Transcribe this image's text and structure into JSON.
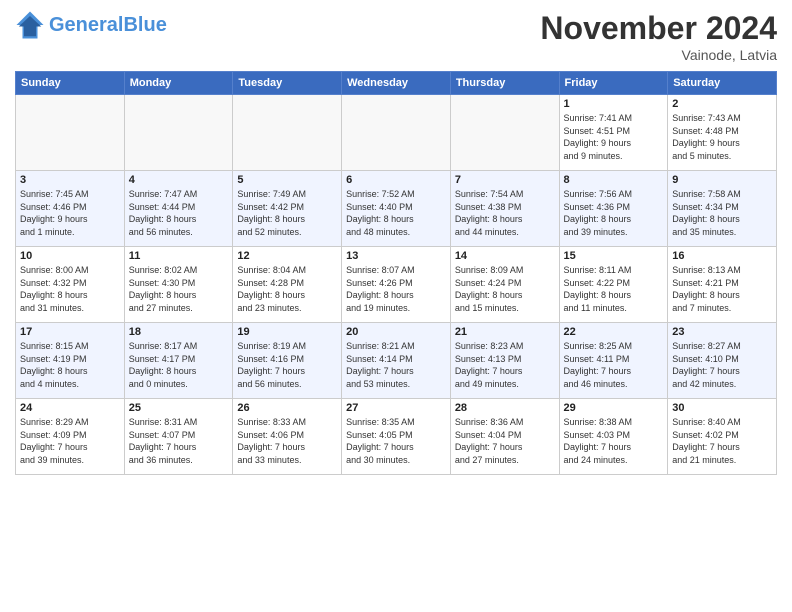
{
  "header": {
    "logo_line1": "General",
    "logo_line2": "Blue",
    "month_title": "November 2024",
    "location": "Vainode, Latvia"
  },
  "weekdays": [
    "Sunday",
    "Monday",
    "Tuesday",
    "Wednesday",
    "Thursday",
    "Friday",
    "Saturday"
  ],
  "weeks": [
    [
      {
        "day": "",
        "info": ""
      },
      {
        "day": "",
        "info": ""
      },
      {
        "day": "",
        "info": ""
      },
      {
        "day": "",
        "info": ""
      },
      {
        "day": "",
        "info": ""
      },
      {
        "day": "1",
        "info": "Sunrise: 7:41 AM\nSunset: 4:51 PM\nDaylight: 9 hours\nand 9 minutes."
      },
      {
        "day": "2",
        "info": "Sunrise: 7:43 AM\nSunset: 4:48 PM\nDaylight: 9 hours\nand 5 minutes."
      }
    ],
    [
      {
        "day": "3",
        "info": "Sunrise: 7:45 AM\nSunset: 4:46 PM\nDaylight: 9 hours\nand 1 minute."
      },
      {
        "day": "4",
        "info": "Sunrise: 7:47 AM\nSunset: 4:44 PM\nDaylight: 8 hours\nand 56 minutes."
      },
      {
        "day": "5",
        "info": "Sunrise: 7:49 AM\nSunset: 4:42 PM\nDaylight: 8 hours\nand 52 minutes."
      },
      {
        "day": "6",
        "info": "Sunrise: 7:52 AM\nSunset: 4:40 PM\nDaylight: 8 hours\nand 48 minutes."
      },
      {
        "day": "7",
        "info": "Sunrise: 7:54 AM\nSunset: 4:38 PM\nDaylight: 8 hours\nand 44 minutes."
      },
      {
        "day": "8",
        "info": "Sunrise: 7:56 AM\nSunset: 4:36 PM\nDaylight: 8 hours\nand 39 minutes."
      },
      {
        "day": "9",
        "info": "Sunrise: 7:58 AM\nSunset: 4:34 PM\nDaylight: 8 hours\nand 35 minutes."
      }
    ],
    [
      {
        "day": "10",
        "info": "Sunrise: 8:00 AM\nSunset: 4:32 PM\nDaylight: 8 hours\nand 31 minutes."
      },
      {
        "day": "11",
        "info": "Sunrise: 8:02 AM\nSunset: 4:30 PM\nDaylight: 8 hours\nand 27 minutes."
      },
      {
        "day": "12",
        "info": "Sunrise: 8:04 AM\nSunset: 4:28 PM\nDaylight: 8 hours\nand 23 minutes."
      },
      {
        "day": "13",
        "info": "Sunrise: 8:07 AM\nSunset: 4:26 PM\nDaylight: 8 hours\nand 19 minutes."
      },
      {
        "day": "14",
        "info": "Sunrise: 8:09 AM\nSunset: 4:24 PM\nDaylight: 8 hours\nand 15 minutes."
      },
      {
        "day": "15",
        "info": "Sunrise: 8:11 AM\nSunset: 4:22 PM\nDaylight: 8 hours\nand 11 minutes."
      },
      {
        "day": "16",
        "info": "Sunrise: 8:13 AM\nSunset: 4:21 PM\nDaylight: 8 hours\nand 7 minutes."
      }
    ],
    [
      {
        "day": "17",
        "info": "Sunrise: 8:15 AM\nSunset: 4:19 PM\nDaylight: 8 hours\nand 4 minutes."
      },
      {
        "day": "18",
        "info": "Sunrise: 8:17 AM\nSunset: 4:17 PM\nDaylight: 8 hours\nand 0 minutes."
      },
      {
        "day": "19",
        "info": "Sunrise: 8:19 AM\nSunset: 4:16 PM\nDaylight: 7 hours\nand 56 minutes."
      },
      {
        "day": "20",
        "info": "Sunrise: 8:21 AM\nSunset: 4:14 PM\nDaylight: 7 hours\nand 53 minutes."
      },
      {
        "day": "21",
        "info": "Sunrise: 8:23 AM\nSunset: 4:13 PM\nDaylight: 7 hours\nand 49 minutes."
      },
      {
        "day": "22",
        "info": "Sunrise: 8:25 AM\nSunset: 4:11 PM\nDaylight: 7 hours\nand 46 minutes."
      },
      {
        "day": "23",
        "info": "Sunrise: 8:27 AM\nSunset: 4:10 PM\nDaylight: 7 hours\nand 42 minutes."
      }
    ],
    [
      {
        "day": "24",
        "info": "Sunrise: 8:29 AM\nSunset: 4:09 PM\nDaylight: 7 hours\nand 39 minutes."
      },
      {
        "day": "25",
        "info": "Sunrise: 8:31 AM\nSunset: 4:07 PM\nDaylight: 7 hours\nand 36 minutes."
      },
      {
        "day": "26",
        "info": "Sunrise: 8:33 AM\nSunset: 4:06 PM\nDaylight: 7 hours\nand 33 minutes."
      },
      {
        "day": "27",
        "info": "Sunrise: 8:35 AM\nSunset: 4:05 PM\nDaylight: 7 hours\nand 30 minutes."
      },
      {
        "day": "28",
        "info": "Sunrise: 8:36 AM\nSunset: 4:04 PM\nDaylight: 7 hours\nand 27 minutes."
      },
      {
        "day": "29",
        "info": "Sunrise: 8:38 AM\nSunset: 4:03 PM\nDaylight: 7 hours\nand 24 minutes."
      },
      {
        "day": "30",
        "info": "Sunrise: 8:40 AM\nSunset: 4:02 PM\nDaylight: 7 hours\nand 21 minutes."
      }
    ]
  ]
}
